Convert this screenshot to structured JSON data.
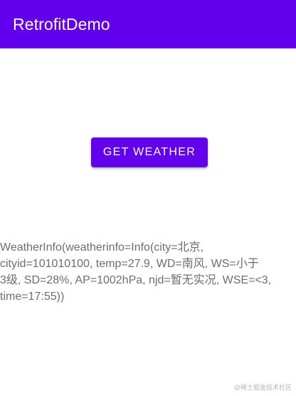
{
  "app_bar": {
    "title": "RetrofitDemo",
    "color": "#6200ee"
  },
  "main": {
    "button_label": "GET WEATHER",
    "weather_info_text": "WeatherInfo(weatherinfo=Info(city=北京,\ncityid=101010100, temp=27.9, WD=南风, WS=小于\n3级, SD=28%, AP=1002hPa, njd=暂无实况, WSE=<3,\ntime=17:55))"
  },
  "watermark": {
    "text": "@稀土掘金技术社区"
  }
}
